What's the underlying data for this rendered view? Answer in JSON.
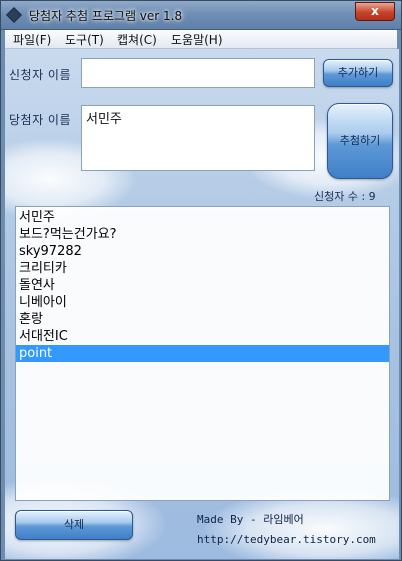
{
  "window": {
    "title": "당첨자 추첨 프로그램 ver 1.8",
    "close_label": "x"
  },
  "menu": [
    {
      "label": "파일(F)"
    },
    {
      "label": "도구(T)"
    },
    {
      "label": "캡쳐(C)"
    },
    {
      "label": "도움말(H)"
    }
  ],
  "form": {
    "applicant_label": "신청자 이름",
    "applicant_value": "",
    "add_button": "추가하기",
    "winner_label": "당첨자 이름",
    "winner_value": "서민주",
    "draw_button": "추첨하기",
    "count_label": "신청자 수 : 9"
  },
  "applicants": [
    {
      "name": "서민주",
      "selected": false
    },
    {
      "name": "보드?먹는건가요?",
      "selected": false
    },
    {
      "name": "sky97282",
      "selected": false
    },
    {
      "name": "크리티카",
      "selected": false
    },
    {
      "name": "돌연사",
      "selected": false
    },
    {
      "name": "니베아이",
      "selected": false
    },
    {
      "name": "혼랑",
      "selected": false
    },
    {
      "name": "서대전IC",
      "selected": false
    },
    {
      "name": "point",
      "selected": true
    }
  ],
  "footer": {
    "delete_button": "삭제",
    "made_by": "Made By - 라임베어",
    "url": "http://tedybear.tistory.com"
  },
  "colors": {
    "selection": "#3399ff",
    "button_gradient_dark": "#3f7fc8",
    "label_text": "#1a2d55"
  }
}
